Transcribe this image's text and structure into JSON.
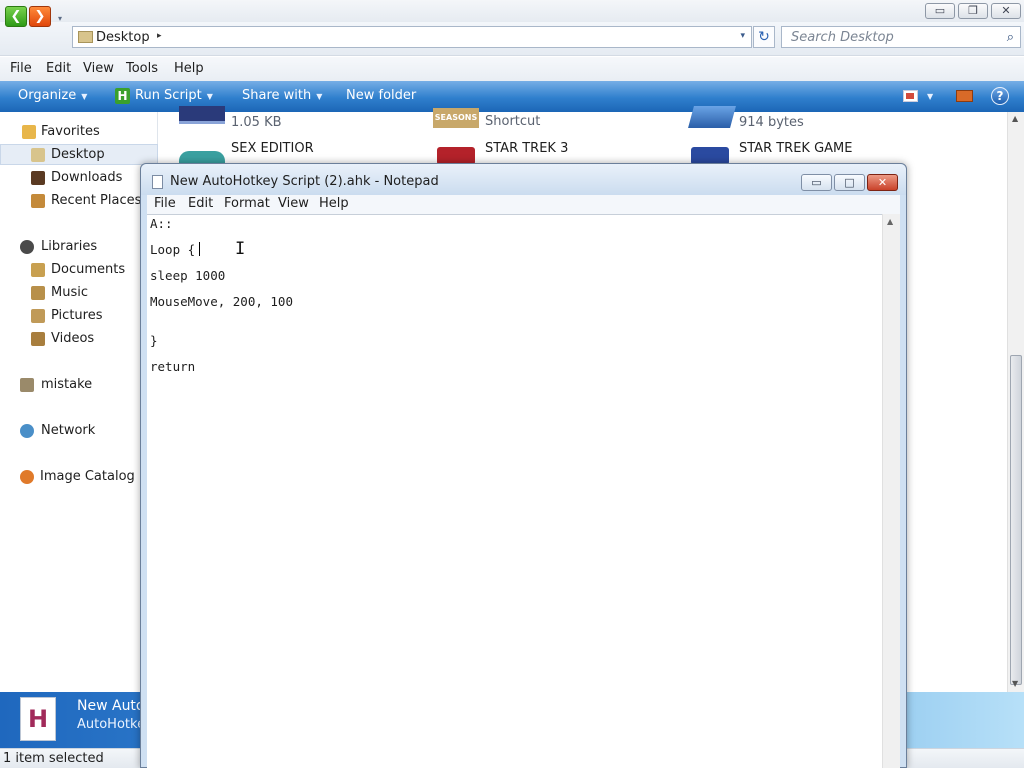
{
  "explorer": {
    "window_controls": {
      "minimize": "▭",
      "restore": "❐",
      "close": "✕"
    },
    "nav": {
      "back": "❮",
      "forward": "❯",
      "recent": "▾"
    },
    "address": {
      "location": "Desktop",
      "separator": "▸",
      "dropdown": "▾"
    },
    "refresh": "↻",
    "search": {
      "placeholder": "Search Desktop",
      "icon": "⌕"
    },
    "menu": [
      "File",
      "Edit",
      "View",
      "Tools",
      "Help"
    ],
    "toolbar": {
      "organize": "Organize",
      "run_script": "Run Script",
      "run_script_icon": "H",
      "share_with": "Share with",
      "new_folder": "New folder",
      "help": "?"
    },
    "sidebar": {
      "favorites": "Favorites",
      "desktop": "Desktop",
      "downloads": "Downloads",
      "recent_places": "Recent Places",
      "libraries": "Libraries",
      "documents": "Documents",
      "music": "Music",
      "pictures": "Pictures",
      "videos": "Videos",
      "mistake": "mistake",
      "network": "Network",
      "image_catalog": "Image Catalog"
    },
    "files": [
      {
        "line1": "",
        "line2": "1.05 KB"
      },
      {
        "line1": "",
        "line2": "Shortcut",
        "thumb_text": "SEASONS"
      },
      {
        "line1": "",
        "line2": "914 bytes"
      },
      {
        "line1": "SEX EDITIOR",
        "line2": ""
      },
      {
        "line1": "STAR TREK 3",
        "line2": ""
      },
      {
        "line1": "STAR TREK GAME",
        "line2": ""
      }
    ],
    "details": {
      "icon_letter": "H",
      "name": "New Auto",
      "type": "AutoHotke"
    },
    "status": "1 item selected",
    "colors": {
      "toolbar": "#2f7fcd",
      "details_pane": "#3a89d6"
    }
  },
  "notepad": {
    "title": "New AutoHotkey Script (2).ahk - Notepad",
    "window_controls": {
      "minimize": "▭",
      "maximize": "□",
      "close": "✕"
    },
    "menu": [
      "File",
      "Edit",
      "Format",
      "View",
      "Help"
    ],
    "lines": [
      "A::",
      "Loop {",
      "sleep 1000",
      "MouseMove, 200, 100",
      "}",
      "return"
    ],
    "ibeam": "I"
  }
}
